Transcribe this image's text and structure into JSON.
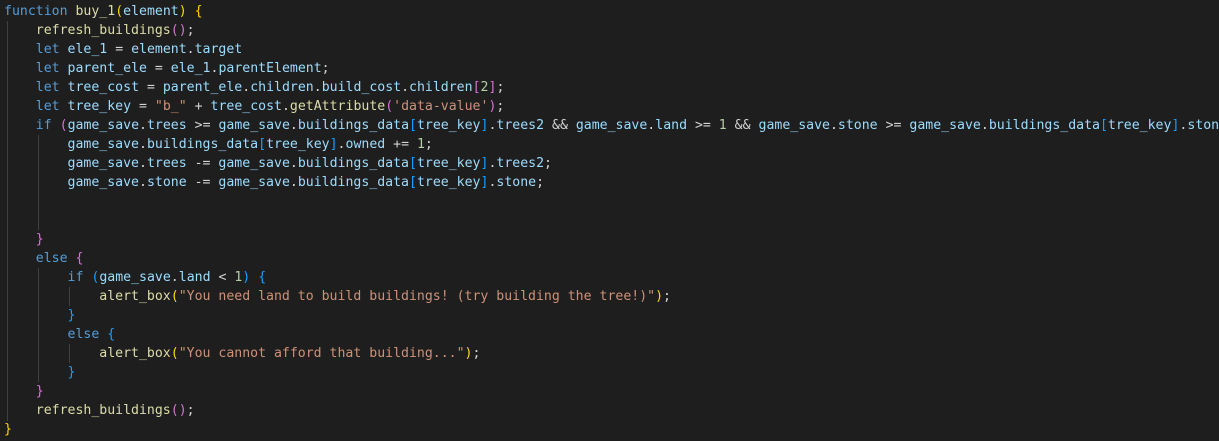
{
  "editor": {
    "background": "#1e1e1e",
    "lines": [
      [
        {
          "t": "function",
          "c": "kw"
        },
        {
          "t": " ",
          "c": "plain"
        },
        {
          "t": "buy_1",
          "c": "fn"
        },
        {
          "t": "(",
          "c": "b1"
        },
        {
          "t": "element",
          "c": "var"
        },
        {
          "t": ")",
          "c": "b1"
        },
        {
          "t": " ",
          "c": "plain"
        },
        {
          "t": "{",
          "c": "b1"
        }
      ],
      [
        {
          "t": "    ",
          "c": "plain"
        },
        {
          "t": "refresh_buildings",
          "c": "fn"
        },
        {
          "t": "()",
          "c": "b2"
        },
        {
          "t": ";",
          "c": "plain"
        }
      ],
      [
        {
          "t": "    ",
          "c": "plain"
        },
        {
          "t": "let",
          "c": "kw"
        },
        {
          "t": " ",
          "c": "plain"
        },
        {
          "t": "ele_1",
          "c": "var"
        },
        {
          "t": " = ",
          "c": "plain"
        },
        {
          "t": "element",
          "c": "var"
        },
        {
          "t": ".",
          "c": "plain"
        },
        {
          "t": "target",
          "c": "var"
        }
      ],
      [
        {
          "t": "    ",
          "c": "plain"
        },
        {
          "t": "let",
          "c": "kw"
        },
        {
          "t": " ",
          "c": "plain"
        },
        {
          "t": "parent_ele",
          "c": "var"
        },
        {
          "t": " = ",
          "c": "plain"
        },
        {
          "t": "ele_1",
          "c": "var"
        },
        {
          "t": ".",
          "c": "plain"
        },
        {
          "t": "parentElement",
          "c": "var"
        },
        {
          "t": ";",
          "c": "plain"
        }
      ],
      [
        {
          "t": "    ",
          "c": "plain"
        },
        {
          "t": "let",
          "c": "kw"
        },
        {
          "t": " ",
          "c": "plain"
        },
        {
          "t": "tree_cost",
          "c": "var"
        },
        {
          "t": " = ",
          "c": "plain"
        },
        {
          "t": "parent_ele",
          "c": "var"
        },
        {
          "t": ".",
          "c": "plain"
        },
        {
          "t": "children",
          "c": "var"
        },
        {
          "t": ".",
          "c": "plain"
        },
        {
          "t": "build_cost",
          "c": "var"
        },
        {
          "t": ".",
          "c": "plain"
        },
        {
          "t": "children",
          "c": "var"
        },
        {
          "t": "[",
          "c": "b2"
        },
        {
          "t": "2",
          "c": "num"
        },
        {
          "t": "]",
          "c": "b2"
        },
        {
          "t": ";",
          "c": "plain"
        }
      ],
      [
        {
          "t": "    ",
          "c": "plain"
        },
        {
          "t": "let",
          "c": "kw"
        },
        {
          "t": " ",
          "c": "plain"
        },
        {
          "t": "tree_key",
          "c": "var"
        },
        {
          "t": " = ",
          "c": "plain"
        },
        {
          "t": "\"b_\"",
          "c": "str"
        },
        {
          "t": " + ",
          "c": "plain"
        },
        {
          "t": "tree_cost",
          "c": "var"
        },
        {
          "t": ".",
          "c": "plain"
        },
        {
          "t": "getAttribute",
          "c": "fn"
        },
        {
          "t": "(",
          "c": "b2"
        },
        {
          "t": "'data-value'",
          "c": "str"
        },
        {
          "t": ")",
          "c": "b2"
        },
        {
          "t": ";",
          "c": "plain"
        }
      ],
      [
        {
          "t": "    ",
          "c": "plain"
        },
        {
          "t": "if",
          "c": "kw"
        },
        {
          "t": " ",
          "c": "plain"
        },
        {
          "t": "(",
          "c": "b2"
        },
        {
          "t": "game_save",
          "c": "var"
        },
        {
          "t": ".",
          "c": "plain"
        },
        {
          "t": "trees",
          "c": "var"
        },
        {
          "t": " >= ",
          "c": "plain"
        },
        {
          "t": "game_save",
          "c": "var"
        },
        {
          "t": ".",
          "c": "plain"
        },
        {
          "t": "buildings_data",
          "c": "var"
        },
        {
          "t": "[",
          "c": "b3"
        },
        {
          "t": "tree_key",
          "c": "var"
        },
        {
          "t": "]",
          "c": "b3"
        },
        {
          "t": ".",
          "c": "plain"
        },
        {
          "t": "trees2",
          "c": "var"
        },
        {
          "t": " && ",
          "c": "plain"
        },
        {
          "t": "game_save",
          "c": "var"
        },
        {
          "t": ".",
          "c": "plain"
        },
        {
          "t": "land",
          "c": "var"
        },
        {
          "t": " >= ",
          "c": "plain"
        },
        {
          "t": "1",
          "c": "num"
        },
        {
          "t": " && ",
          "c": "plain"
        },
        {
          "t": "game_save",
          "c": "var"
        },
        {
          "t": ".",
          "c": "plain"
        },
        {
          "t": "stone",
          "c": "var"
        },
        {
          "t": " >= ",
          "c": "plain"
        },
        {
          "t": "game_save",
          "c": "var"
        },
        {
          "t": ".",
          "c": "plain"
        },
        {
          "t": "buildings_data",
          "c": "var"
        },
        {
          "t": "[",
          "c": "b3"
        },
        {
          "t": "tree_key",
          "c": "var"
        },
        {
          "t": "]",
          "c": "b3"
        },
        {
          "t": ".",
          "c": "plain"
        },
        {
          "t": "stone",
          "c": "var"
        },
        {
          "t": ")",
          "c": "b2"
        },
        {
          "t": " ",
          "c": "plain"
        },
        {
          "t": "{",
          "c": "b2"
        }
      ],
      [
        {
          "t": "        ",
          "c": "plain"
        },
        {
          "t": "game_save",
          "c": "var"
        },
        {
          "t": ".",
          "c": "plain"
        },
        {
          "t": "buildings_data",
          "c": "var"
        },
        {
          "t": "[",
          "c": "b3"
        },
        {
          "t": "tree_key",
          "c": "var"
        },
        {
          "t": "]",
          "c": "b3"
        },
        {
          "t": ".",
          "c": "plain"
        },
        {
          "t": "owned",
          "c": "var"
        },
        {
          "t": " += ",
          "c": "plain"
        },
        {
          "t": "1",
          "c": "num"
        },
        {
          "t": ";",
          "c": "plain"
        }
      ],
      [
        {
          "t": "        ",
          "c": "plain"
        },
        {
          "t": "game_save",
          "c": "var"
        },
        {
          "t": ".",
          "c": "plain"
        },
        {
          "t": "trees",
          "c": "var"
        },
        {
          "t": " -= ",
          "c": "plain"
        },
        {
          "t": "game_save",
          "c": "var"
        },
        {
          "t": ".",
          "c": "plain"
        },
        {
          "t": "buildings_data",
          "c": "var"
        },
        {
          "t": "[",
          "c": "b3"
        },
        {
          "t": "tree_key",
          "c": "var"
        },
        {
          "t": "]",
          "c": "b3"
        },
        {
          "t": ".",
          "c": "plain"
        },
        {
          "t": "trees2",
          "c": "var"
        },
        {
          "t": ";",
          "c": "plain"
        }
      ],
      [
        {
          "t": "        ",
          "c": "plain"
        },
        {
          "t": "game_save",
          "c": "var"
        },
        {
          "t": ".",
          "c": "plain"
        },
        {
          "t": "stone",
          "c": "var"
        },
        {
          "t": " -= ",
          "c": "plain"
        },
        {
          "t": "game_save",
          "c": "var"
        },
        {
          "t": ".",
          "c": "plain"
        },
        {
          "t": "buildings_data",
          "c": "var"
        },
        {
          "t": "[",
          "c": "b3"
        },
        {
          "t": "tree_key",
          "c": "var"
        },
        {
          "t": "]",
          "c": "b3"
        },
        {
          "t": ".",
          "c": "plain"
        },
        {
          "t": "stone",
          "c": "var"
        },
        {
          "t": ";",
          "c": "plain"
        }
      ],
      [],
      [],
      [
        {
          "t": "    ",
          "c": "plain"
        },
        {
          "t": "}",
          "c": "b2"
        }
      ],
      [
        {
          "t": "    ",
          "c": "plain"
        },
        {
          "t": "else",
          "c": "kw"
        },
        {
          "t": " ",
          "c": "plain"
        },
        {
          "t": "{",
          "c": "b2"
        }
      ],
      [
        {
          "t": "        ",
          "c": "plain"
        },
        {
          "t": "if",
          "c": "kw"
        },
        {
          "t": " ",
          "c": "plain"
        },
        {
          "t": "(",
          "c": "b3"
        },
        {
          "t": "game_save",
          "c": "var"
        },
        {
          "t": ".",
          "c": "plain"
        },
        {
          "t": "land",
          "c": "var"
        },
        {
          "t": " < ",
          "c": "plain"
        },
        {
          "t": "1",
          "c": "num"
        },
        {
          "t": ")",
          "c": "b3"
        },
        {
          "t": " ",
          "c": "plain"
        },
        {
          "t": "{",
          "c": "b3"
        }
      ],
      [
        {
          "t": "            ",
          "c": "plain"
        },
        {
          "t": "alert_box",
          "c": "fn"
        },
        {
          "t": "(",
          "c": "b1"
        },
        {
          "t": "\"You need land to build buildings! (try building the tree!)\"",
          "c": "str"
        },
        {
          "t": ")",
          "c": "b1"
        },
        {
          "t": ";",
          "c": "plain"
        }
      ],
      [
        {
          "t": "        ",
          "c": "plain"
        },
        {
          "t": "}",
          "c": "b3"
        }
      ],
      [
        {
          "t": "        ",
          "c": "plain"
        },
        {
          "t": "else",
          "c": "kw"
        },
        {
          "t": " ",
          "c": "plain"
        },
        {
          "t": "{",
          "c": "b3"
        }
      ],
      [
        {
          "t": "            ",
          "c": "plain"
        },
        {
          "t": "alert_box",
          "c": "fn"
        },
        {
          "t": "(",
          "c": "b1"
        },
        {
          "t": "\"You cannot afford that building...\"",
          "c": "str"
        },
        {
          "t": ")",
          "c": "b1"
        },
        {
          "t": ";",
          "c": "plain"
        }
      ],
      [
        {
          "t": "        ",
          "c": "plain"
        },
        {
          "t": "}",
          "c": "b3"
        }
      ],
      [
        {
          "t": "    ",
          "c": "plain"
        },
        {
          "t": "}",
          "c": "b2"
        }
      ],
      [
        {
          "t": "    ",
          "c": "plain"
        },
        {
          "t": "refresh_buildings",
          "c": "fn"
        },
        {
          "t": "()",
          "c": "b2"
        },
        {
          "t": ";",
          "c": "plain"
        }
      ],
      [
        {
          "t": "}",
          "c": "b1"
        }
      ]
    ]
  }
}
